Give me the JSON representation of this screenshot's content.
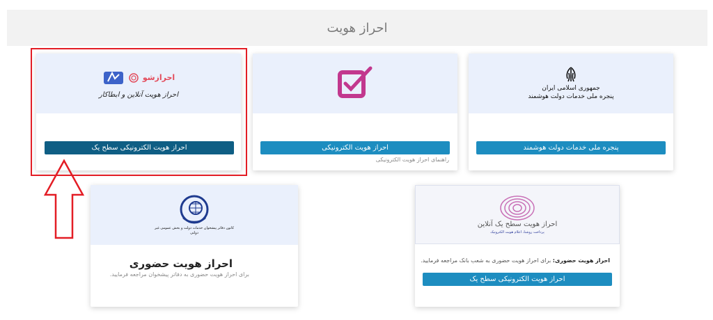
{
  "page": {
    "title": "احراز هویت"
  },
  "cards": {
    "sath_yek": {
      "logo_brand": "احرازشو",
      "logo_caption": "احراز هویت آنلاین و ابطاکار",
      "button": "احراز هویت الکترونیکی سطح یک"
    },
    "electronic": {
      "button": "احراز هویت الکترونیکی",
      "note": "راهنمای احراز هویت الکترونیکی"
    },
    "dolat": {
      "logo_line1": "جمهوری اسلامی ایران",
      "logo_line2": "پنجره ملی خدمات دولت هوشمند",
      "button": "پنجره ملی خدمات دولت هوشمند"
    },
    "hozuri": {
      "logo_caption": "کانون دفاتر پیشخوان خدمات دولت و بخش عمومی غیر دولتی",
      "title": "احراز هویت حضوری",
      "note": "برای احراز هویت حضوری به دفاتر پیشخوان مراجعه فرمایید."
    },
    "online": {
      "logo_title": "احراز هویت سطح یک آنلاین",
      "logo_caption": "پرداخت روشنا، اعلام هویت الکترونیک",
      "desc_bold": "احراز هویت حضوری:",
      "desc_rest": " برای احراز هویت حضوری به شعب بانک مراجعه فرمایید.",
      "button": "احراز هویت الکترونیکی سطح یک"
    }
  },
  "colors": {
    "button_blue": "#1d8dc0",
    "button_dark": "#0f5e84",
    "highlight_red": "#e31d25"
  }
}
